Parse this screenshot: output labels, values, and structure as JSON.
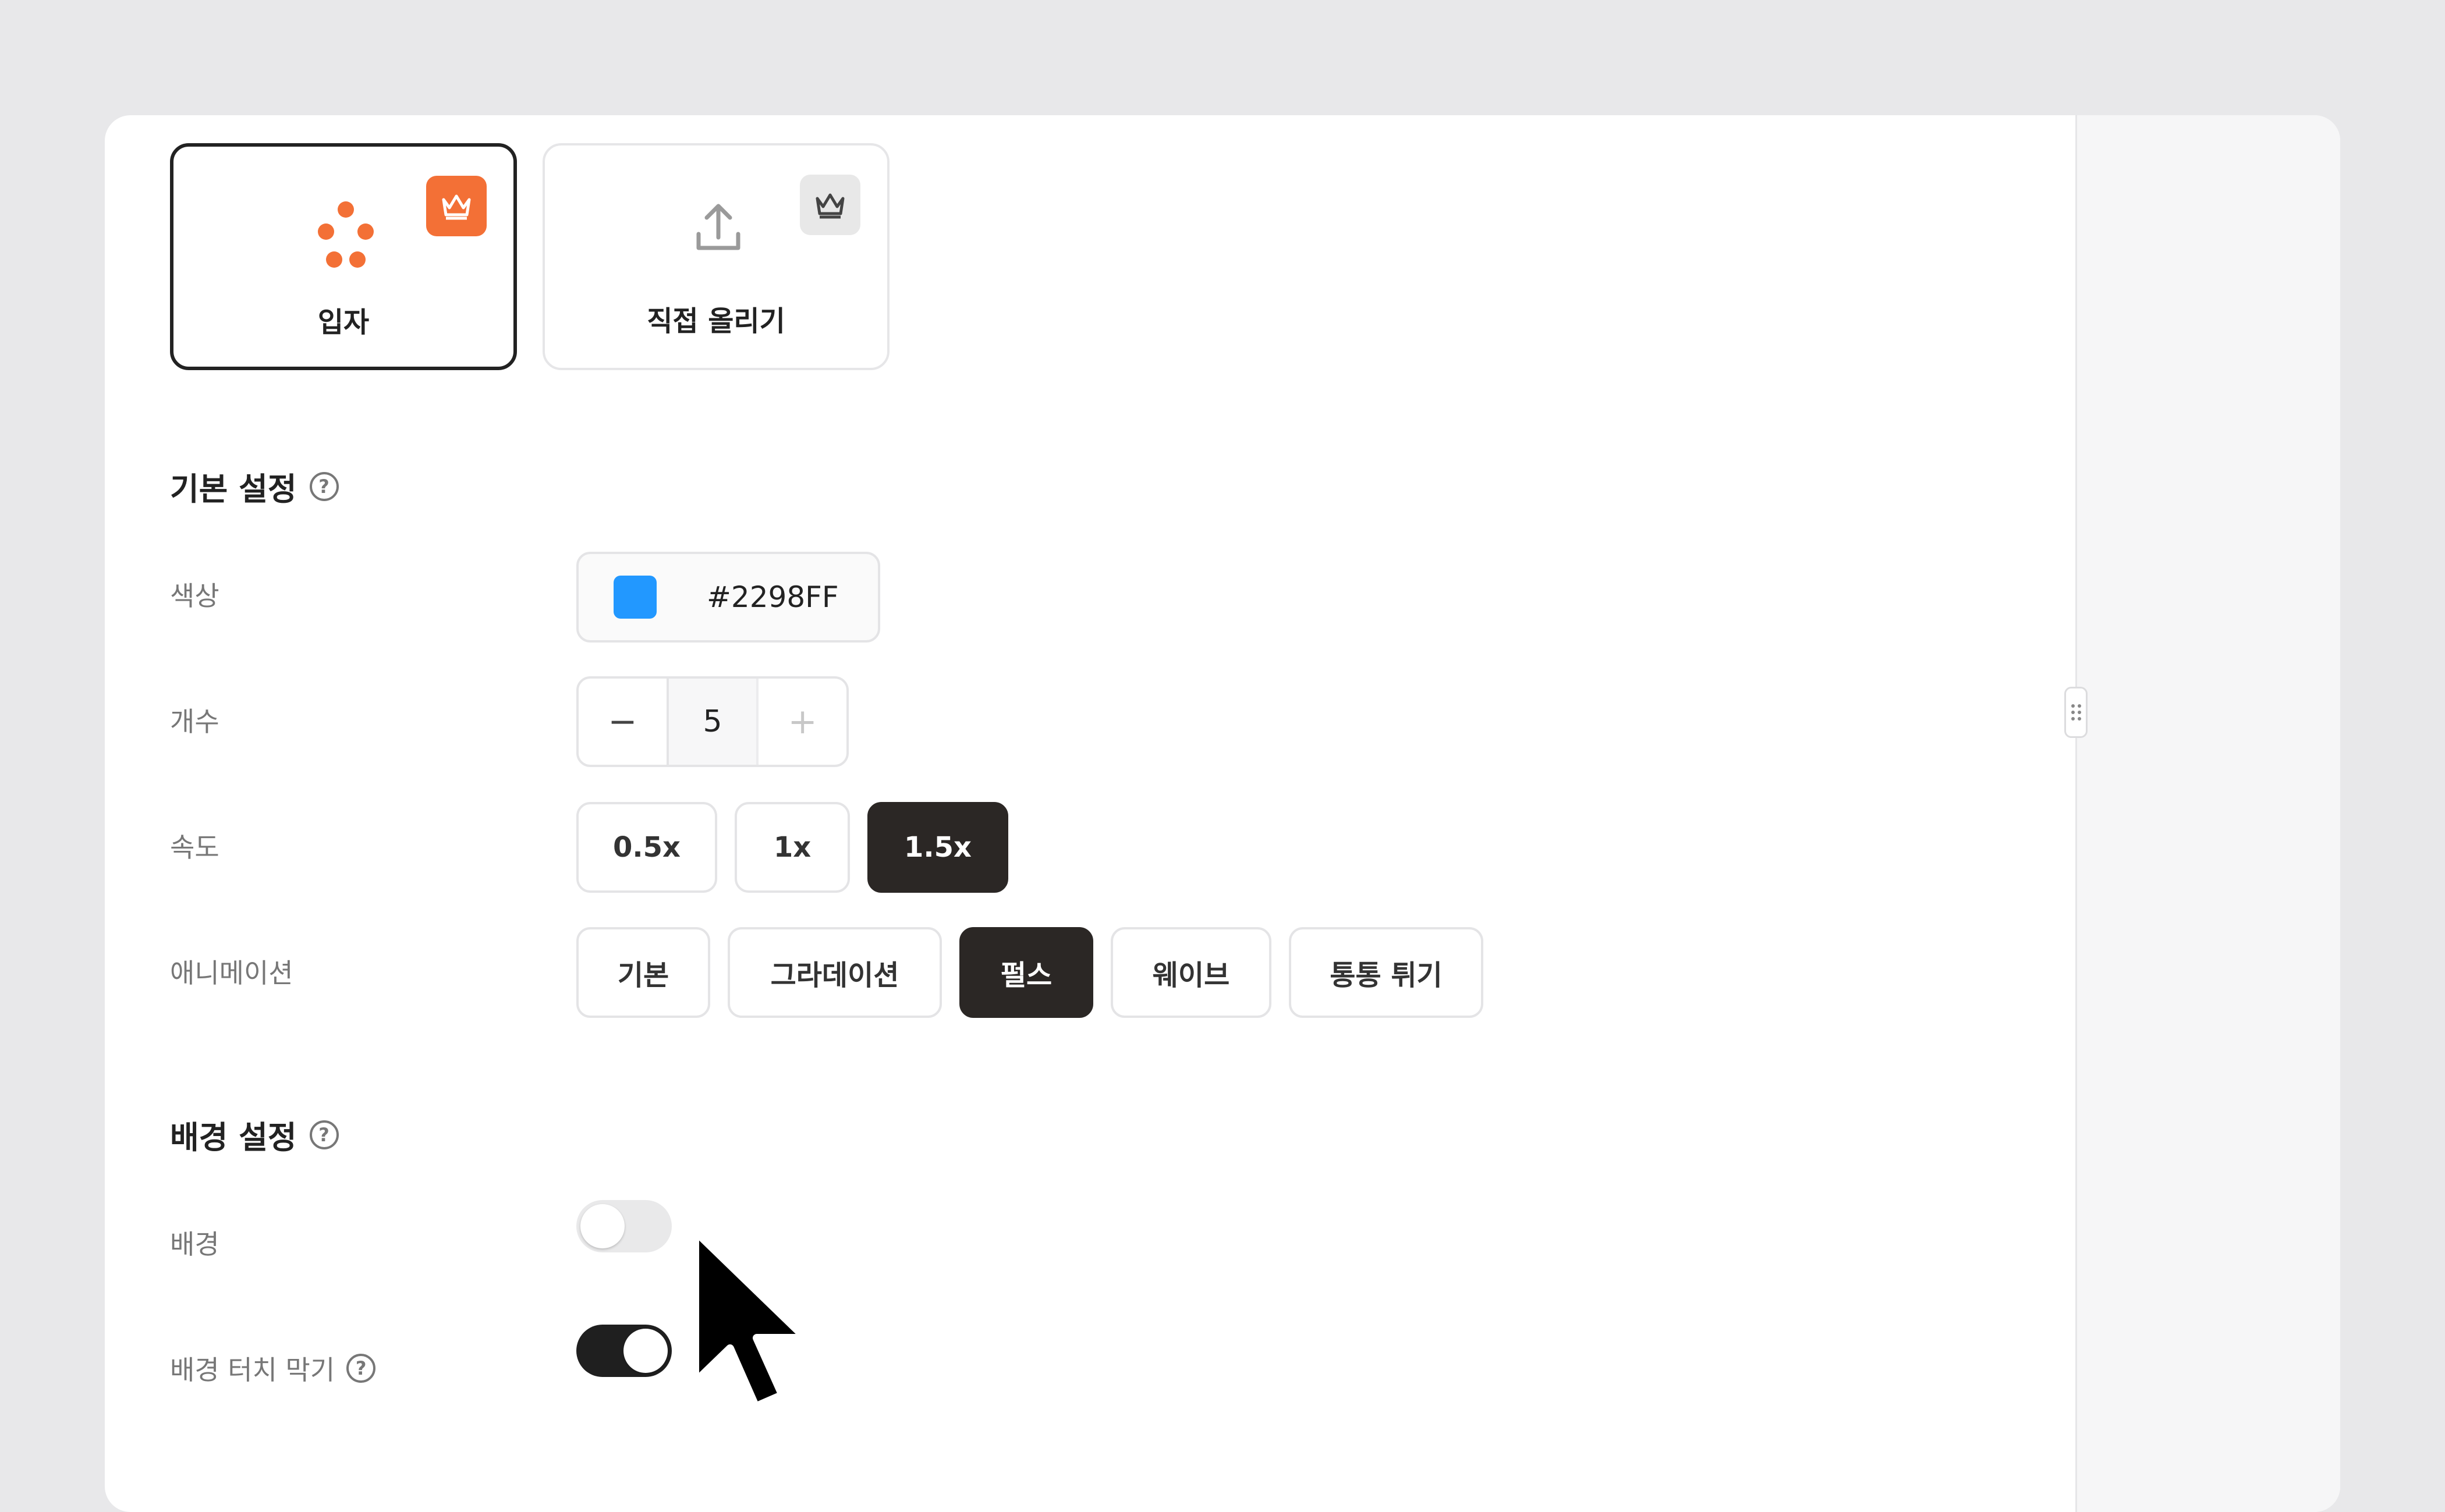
{
  "effect_cards": [
    {
      "label": "입자",
      "selected": true,
      "icon": "particles-icon",
      "badge": "crown-icon"
    },
    {
      "label": "직접 올리기",
      "selected": false,
      "icon": "upload-icon",
      "badge": "crown-icon"
    }
  ],
  "basic_settings": {
    "title": "기본 설정",
    "help": "?",
    "color": {
      "label": "색상",
      "value": "#2298FF"
    },
    "count": {
      "label": "개수",
      "value": "5",
      "minus": "−",
      "plus": "+"
    },
    "speed": {
      "label": "속도",
      "options": [
        "0.5x",
        "1x",
        "1.5x"
      ],
      "selected": "1.5x"
    },
    "animation": {
      "label": "애니메이션",
      "options": [
        "기본",
        "그라데이션",
        "펄스",
        "웨이브",
        "통통 튀기"
      ],
      "selected": "펄스"
    }
  },
  "background_settings": {
    "title": "배경 설정",
    "help": "?",
    "background": {
      "label": "배경",
      "on": false
    },
    "block_touch": {
      "label": "배경 터치 막기",
      "help": "?",
      "on": true
    }
  },
  "colors": {
    "accent": "#f37036",
    "swatch": "#2298FF",
    "active": "#2b2725"
  }
}
